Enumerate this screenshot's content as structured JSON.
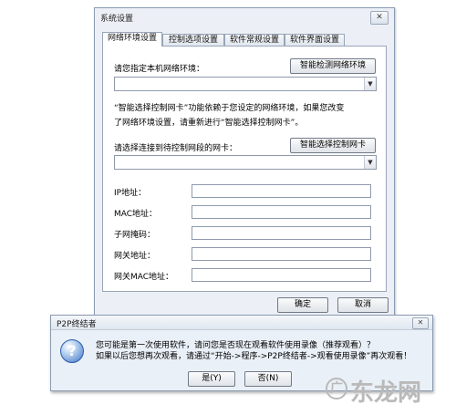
{
  "settings_window": {
    "title": "系统设置",
    "close_glyph": "✕",
    "tabs": [
      {
        "label": "网络环境设置",
        "active": true
      },
      {
        "label": "控制选项设置",
        "active": false
      },
      {
        "label": "软件常规设置",
        "active": false
      },
      {
        "label": "软件界面设置",
        "active": false
      }
    ],
    "network_env_label": "请您指定本机网络环境：",
    "detect_button": "智能检测网络环境",
    "network_env_value": "",
    "note_line1": "“智能选择控制网卡”功能依赖于您设定的网络环境，如果您改变",
    "note_line2": "了网络环境设置，请重新进行“智能选择控制网卡”。",
    "nic_label": "请选择连接到待控制网段的网卡：",
    "nic_button": "智能选择控制网卡",
    "nic_value": "",
    "fields": [
      {
        "label": "IP地址：",
        "value": ""
      },
      {
        "label": "MAC地址：",
        "value": ""
      },
      {
        "label": "子网掩码：",
        "value": ""
      },
      {
        "label": "网关地址：",
        "value": ""
      },
      {
        "label": "网关MAC地址：",
        "value": ""
      }
    ],
    "ok_button": "确定",
    "cancel_button": "取消",
    "dropdown_glyph": "▼"
  },
  "dialog": {
    "title": "P2P终结者",
    "close_glyph": "✕",
    "icon_glyph": "?",
    "message_line1": "您可能是第一次使用软件，请问您是否现在观看软件使用录像（推荐观看）？",
    "message_line2": "如果以后您想再次观看，请通过“开始->程序->P2P终结者->观看使用录像”再次观看！",
    "yes_button": "是(Y)",
    "no_button": "否(N)"
  },
  "watermark": {
    "badge": "广",
    "text": "东龙网"
  }
}
